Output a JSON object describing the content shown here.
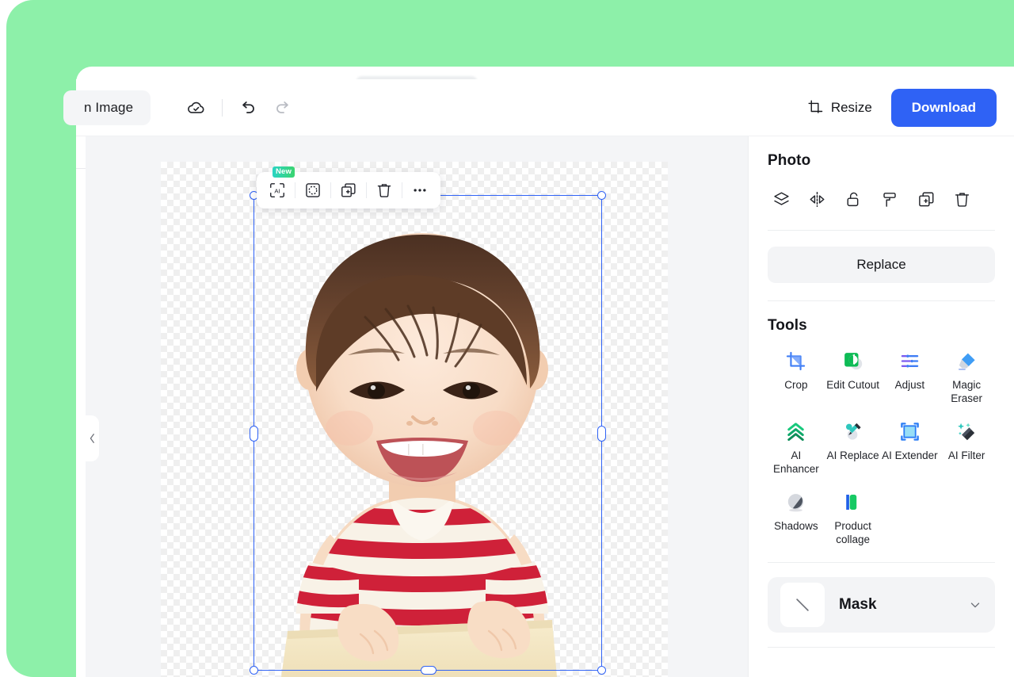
{
  "theme": {
    "background_green": "#8df0a9",
    "accent_blue": "#2f62f5",
    "panel_gray": "#f3f4f6",
    "canvas_gray": "#f4f5f7"
  },
  "toolbar": {
    "document_tab_label": "n Image",
    "cloud_save_icon": "cloud-check-icon",
    "undo_icon": "undo-icon",
    "redo_icon": "redo-icon",
    "resize_label": "Resize",
    "resize_icon": "resize-icon",
    "download_label": "Download"
  },
  "canvas": {
    "collapse_icon": "chevron-left-icon",
    "object_toolbar": {
      "items": [
        {
          "name": "ai-tool-button",
          "icon": "ai-scan-icon",
          "badge": "New"
        },
        {
          "name": "cutout-button",
          "icon": "circle-dashed-icon",
          "badge": ""
        },
        {
          "name": "duplicate-button",
          "icon": "duplicate-icon",
          "badge": ""
        },
        {
          "name": "delete-button",
          "icon": "trash-icon",
          "badge": ""
        },
        {
          "name": "more-button",
          "icon": "ellipsis-icon",
          "badge": ""
        }
      ]
    },
    "selection": {
      "handles": [
        "top-left",
        "top-right",
        "bottom-left",
        "bottom-right",
        "left-middle",
        "right-middle",
        "bottom-middle"
      ]
    },
    "photo_alt": "Smiling baby in red and white striped shirt, background removed"
  },
  "right_panel": {
    "photo_section": {
      "title": "Photo",
      "icons": [
        {
          "name": "layers-icon",
          "label": "Layers"
        },
        {
          "name": "flip-horizontal-icon",
          "label": "Flip"
        },
        {
          "name": "unlock-icon",
          "label": "Unlock"
        },
        {
          "name": "paint-roller-icon",
          "label": "Paint"
        },
        {
          "name": "duplicate-icon",
          "label": "Duplicate"
        },
        {
          "name": "trash-icon",
          "label": "Delete"
        }
      ],
      "replace_label": "Replace"
    },
    "tools_section": {
      "title": "Tools",
      "items": [
        {
          "label": "Crop",
          "icon": "crop-icon"
        },
        {
          "label": "Edit Cutout",
          "icon": "edit-cutout-icon"
        },
        {
          "label": "Adjust",
          "icon": "adjust-icon"
        },
        {
          "label": "Magic Eraser",
          "icon": "magic-eraser-icon"
        },
        {
          "label": "AI Enhancer",
          "icon": "ai-enhancer-icon"
        },
        {
          "label": "AI Replace",
          "icon": "ai-replace-icon"
        },
        {
          "label": "AI Extender",
          "icon": "ai-extender-icon"
        },
        {
          "label": "AI Filter",
          "icon": "ai-filter-icon"
        },
        {
          "label": "Shadows",
          "icon": "shadows-icon"
        },
        {
          "label": "Product collage",
          "icon": "product-collage-icon"
        }
      ]
    },
    "mask_section": {
      "label": "Mask",
      "thumb_icon": "diagonal-line-icon",
      "chevron_icon": "chevron-down-icon"
    }
  }
}
